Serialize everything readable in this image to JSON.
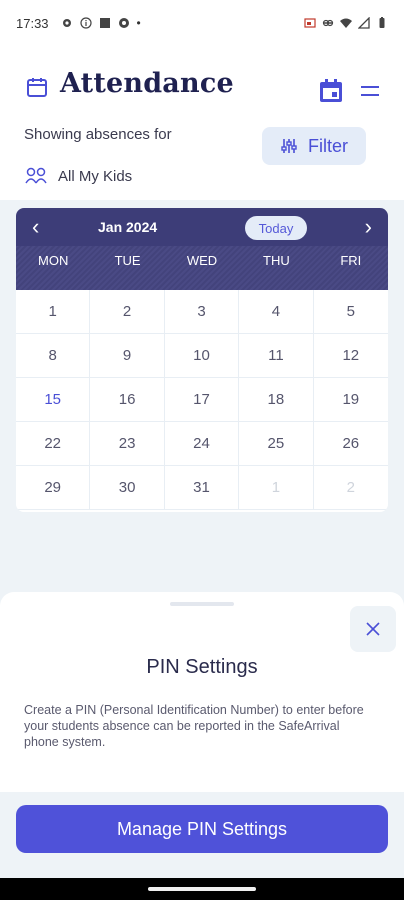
{
  "status": {
    "time": "17:33",
    "icons_left": [
      "gear-icon",
      "info-icon",
      "square-icon",
      "chrome-icon"
    ],
    "dot": "•",
    "icons_right": [
      "cast-icon",
      "link-icon",
      "wifi-icon",
      "signal-icon",
      "battery-icon"
    ]
  },
  "header": {
    "title": "Attendance"
  },
  "filter": {
    "showing_label": "Showing absences for",
    "button_label": "Filter",
    "kids_label": "All My Kids"
  },
  "calendar": {
    "prev": "‹",
    "next": "›",
    "month": "Jan 2024",
    "today_label": "Today",
    "weekdays": [
      "MON",
      "TUE",
      "WED",
      "THU",
      "FRI"
    ],
    "days": [
      "1",
      "2",
      "3",
      "4",
      "5",
      "8",
      "9",
      "10",
      "11",
      "12",
      "15",
      "16",
      "17",
      "18",
      "19",
      "22",
      "23",
      "24",
      "25",
      "26",
      "29",
      "30",
      "31",
      "1",
      "2"
    ],
    "highlight_day": "15"
  },
  "sheet": {
    "title": "PIN Settings",
    "description": "Create a PIN (Personal Identification Number) to enter before your students absence can be reported in the SafeArrival phone system.",
    "button_label": "Manage PIN Settings"
  },
  "colors": {
    "accent": "#4f52d9",
    "calendar_header": "#3d3d78",
    "title": "#1f2150"
  }
}
